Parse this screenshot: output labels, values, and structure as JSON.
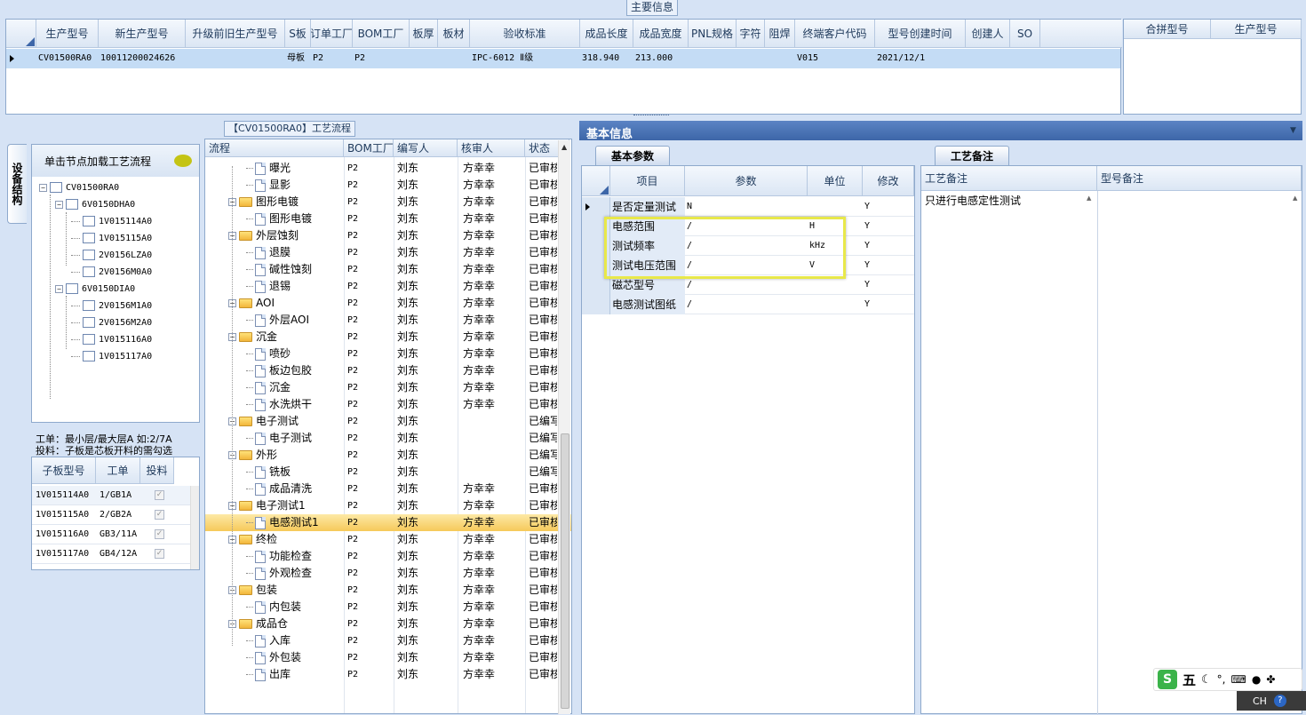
{
  "top": {
    "title": "主要信息",
    "columns": [
      "生产型号",
      "新生产型号",
      "升级前旧生产型号",
      "S板",
      "订单工厂",
      "BOM工厂",
      "板厚",
      "板材",
      "验收标准",
      "成品长度",
      "成品宽度",
      "PNL规格",
      "字符",
      "阻焊",
      "终端客户代码",
      "型号创建时间",
      "创建人",
      "SO"
    ],
    "row": [
      "CV01500RA0",
      "10011200024626",
      "",
      "母板",
      "P2",
      "P2",
      "",
      "",
      "IPC-6012 Ⅱ级",
      "318.940",
      "213.000",
      "",
      "",
      "",
      "V015",
      "2021/12/1",
      "",
      ""
    ],
    "right_columns": [
      "合拼型号",
      "生产型号"
    ]
  },
  "left": {
    "side_tab": "设备结构",
    "flow_title": "【CV01500RA0】工艺流程",
    "hint": "单击节点加载工艺流程",
    "tree": [
      {
        "label": "CV01500RA0",
        "level": 0
      },
      {
        "label": "6V0150DHA0",
        "level": 1
      },
      {
        "label": "1V015114A0",
        "level": 2
      },
      {
        "label": "1V015115A0",
        "level": 2
      },
      {
        "label": "2V0156LZA0",
        "level": 2
      },
      {
        "label": "2V0156M0A0",
        "level": 2
      },
      {
        "label": "6V0150DIA0",
        "level": 1
      },
      {
        "label": "2V0156M1A0",
        "level": 2
      },
      {
        "label": "2V0156M2A0",
        "level": 2
      },
      {
        "label": "1V015116A0",
        "level": 2
      },
      {
        "label": "1V015117A0",
        "level": 2
      }
    ],
    "note1": "工单：最小层/最大层A 如:2/7A",
    "note2": "投料：子板是芯板开料的需勾选",
    "sub_columns": [
      "子板型号",
      "工单",
      "投料"
    ],
    "sub_rows": [
      {
        "model": "1V015114A0",
        "order": "1/GB1A"
      },
      {
        "model": "1V015115A0",
        "order": "2/GB2A"
      },
      {
        "model": "1V015116A0",
        "order": "GB3/11A"
      },
      {
        "model": "1V015117A0",
        "order": "GB4/12A"
      }
    ]
  },
  "flow": {
    "columns": [
      "流程",
      "BOM工厂",
      "编写人",
      "核审人",
      "状态"
    ],
    "rows": [
      {
        "name": "曝光",
        "folder": false,
        "bom": "P2",
        "writer": "刘东",
        "reviewer": "方幸幸",
        "status": "已审核"
      },
      {
        "name": "显影",
        "folder": false,
        "bom": "P2",
        "writer": "刘东",
        "reviewer": "方幸幸",
        "status": "已审核"
      },
      {
        "name": "图形电镀",
        "folder": true,
        "bom": "P2",
        "writer": "刘东",
        "reviewer": "方幸幸",
        "status": "已审核"
      },
      {
        "name": "图形电镀",
        "folder": false,
        "bom": "P2",
        "writer": "刘东",
        "reviewer": "方幸幸",
        "status": "已审核"
      },
      {
        "name": "外层蚀刻",
        "folder": true,
        "bom": "P2",
        "writer": "刘东",
        "reviewer": "方幸幸",
        "status": "已审核"
      },
      {
        "name": "退膜",
        "folder": false,
        "bom": "P2",
        "writer": "刘东",
        "reviewer": "方幸幸",
        "status": "已审核"
      },
      {
        "name": "碱性蚀刻",
        "folder": false,
        "bom": "P2",
        "writer": "刘东",
        "reviewer": "方幸幸",
        "status": "已审核"
      },
      {
        "name": "退锡",
        "folder": false,
        "bom": "P2",
        "writer": "刘东",
        "reviewer": "方幸幸",
        "status": "已审核"
      },
      {
        "name": "AOI",
        "folder": true,
        "bom": "P2",
        "writer": "刘东",
        "reviewer": "方幸幸",
        "status": "已审核"
      },
      {
        "name": "外层AOI",
        "folder": false,
        "bom": "P2",
        "writer": "刘东",
        "reviewer": "方幸幸",
        "status": "已审核"
      },
      {
        "name": "沉金",
        "folder": true,
        "bom": "P2",
        "writer": "刘东",
        "reviewer": "方幸幸",
        "status": "已审核"
      },
      {
        "name": "喷砂",
        "folder": false,
        "bom": "P2",
        "writer": "刘东",
        "reviewer": "方幸幸",
        "status": "已审核"
      },
      {
        "name": "板边包胶",
        "folder": false,
        "bom": "P2",
        "writer": "刘东",
        "reviewer": "方幸幸",
        "status": "已审核"
      },
      {
        "name": "沉金",
        "folder": false,
        "bom": "P2",
        "writer": "刘东",
        "reviewer": "方幸幸",
        "status": "已审核"
      },
      {
        "name": "水洗烘干",
        "folder": false,
        "bom": "P2",
        "writer": "刘东",
        "reviewer": "方幸幸",
        "status": "已审核"
      },
      {
        "name": "电子测试",
        "folder": true,
        "bom": "P2",
        "writer": "刘东",
        "reviewer": "",
        "status": "已编写"
      },
      {
        "name": "电子测试",
        "folder": false,
        "bom": "P2",
        "writer": "刘东",
        "reviewer": "",
        "status": "已编写"
      },
      {
        "name": "外形",
        "folder": true,
        "bom": "P2",
        "writer": "刘东",
        "reviewer": "",
        "status": "已编写"
      },
      {
        "name": "铣板",
        "folder": false,
        "bom": "P2",
        "writer": "刘东",
        "reviewer": "",
        "status": "已编写"
      },
      {
        "name": "成品清洗",
        "folder": false,
        "bom": "P2",
        "writer": "刘东",
        "reviewer": "方幸幸",
        "status": "已审核"
      },
      {
        "name": "电子测试1",
        "folder": true,
        "bom": "P2",
        "writer": "刘东",
        "reviewer": "方幸幸",
        "status": "已审核"
      },
      {
        "name": "电感测试1",
        "folder": false,
        "bom": "P2",
        "writer": "刘东",
        "reviewer": "方幸幸",
        "status": "已审核",
        "selected": true
      },
      {
        "name": "终检",
        "folder": true,
        "bom": "P2",
        "writer": "刘东",
        "reviewer": "方幸幸",
        "status": "已审核"
      },
      {
        "name": "功能检查",
        "folder": false,
        "bom": "P2",
        "writer": "刘东",
        "reviewer": "方幸幸",
        "status": "已审核"
      },
      {
        "name": "外观检查",
        "folder": false,
        "bom": "P2",
        "writer": "刘东",
        "reviewer": "方幸幸",
        "status": "已审核"
      },
      {
        "name": "包装",
        "folder": true,
        "bom": "P2",
        "writer": "刘东",
        "reviewer": "方幸幸",
        "status": "已审核"
      },
      {
        "name": "内包装",
        "folder": false,
        "bom": "P2",
        "writer": "刘东",
        "reviewer": "方幸幸",
        "status": "已审核"
      },
      {
        "name": "成品仓",
        "folder": true,
        "bom": "P2",
        "writer": "刘东",
        "reviewer": "方幸幸",
        "status": "已审核"
      },
      {
        "name": "入库",
        "folder": false,
        "bom": "P2",
        "writer": "刘东",
        "reviewer": "方幸幸",
        "status": "已审核"
      },
      {
        "name": "外包装",
        "folder": false,
        "bom": "P2",
        "writer": "刘东",
        "reviewer": "方幸幸",
        "status": "已审核"
      },
      {
        "name": "出库",
        "folder": false,
        "bom": "P2",
        "writer": "刘东",
        "reviewer": "方幸幸",
        "status": "已审核"
      }
    ]
  },
  "basic": {
    "title": "基本信息",
    "tab": "基本参数",
    "columns": [
      "项目",
      "参数",
      "单位",
      "修改"
    ],
    "rows": [
      {
        "item": "是否定量测试",
        "param": "N",
        "unit": "",
        "mod": "Y"
      },
      {
        "item": "电感范围",
        "param": "/",
        "unit": "H",
        "mod": "Y"
      },
      {
        "item": "测试频率",
        "param": "/",
        "unit": "kHz",
        "mod": "Y"
      },
      {
        "item": "测试电压范围",
        "param": "/",
        "unit": "V",
        "mod": "Y"
      },
      {
        "item": "磁芯型号",
        "param": "/",
        "unit": "",
        "mod": "Y"
      },
      {
        "item": "电感测试图纸",
        "param": "/",
        "unit": "",
        "mod": "Y"
      }
    ]
  },
  "remarks": {
    "tab": "工艺备注",
    "col1": "工艺备注",
    "col2": "型号备注",
    "text": "只进行电感定性测试"
  },
  "ime": {
    "label": "五",
    "lang": "CH"
  },
  "colors": {
    "header_bg": "#dbe6f4",
    "selected_row": "#f9d46a",
    "highlight_box": "#e8e84a",
    "top_row": "#c4dcf5"
  }
}
